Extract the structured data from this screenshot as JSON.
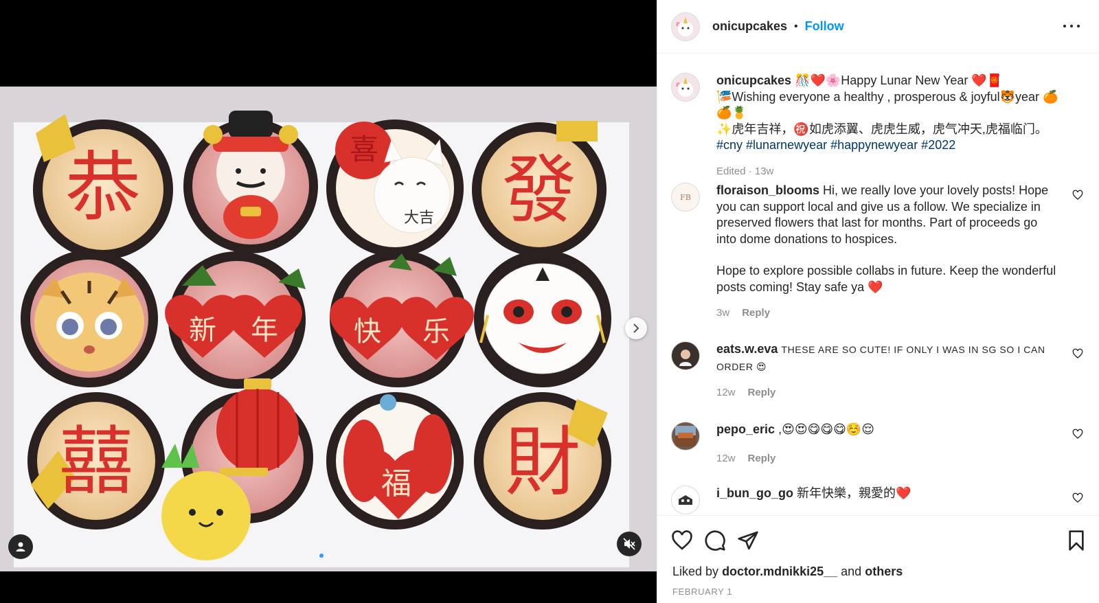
{
  "post": {
    "author": "onicupcakes",
    "follow_label": "Follow",
    "separator": "•",
    "caption_line1": "🎊❤️🌸Happy Lunar New Year ❤️🧧",
    "caption_line2": "🎏Wishing everyone a healthy , prosperous & joyful🐯year 🍊🍊🍍",
    "caption_line3": "✨虎年吉祥，㊗️如虎添翼、虎虎生威，虎气冲天,虎福临门。",
    "hashtags": "#cny #lunarnewyear #happynewyear #2022",
    "edited": "Edited · 13w"
  },
  "comments": [
    {
      "user": "floraison_blooms",
      "text1": "Hi, we really love your lovely posts! Hope you can support local and give us a follow. We specialize in preserved flowers that last for months. Part of proceeds go into dome donations to hospices.",
      "text2": "Hope to explore possible collabs in future. Keep the wonderful posts coming! Stay safe ya ❤️",
      "time": "3w",
      "reply": "Reply"
    },
    {
      "user": "eats.w.eva",
      "text": "These are so cute! If only I was in SG so I can order 😍",
      "time": "12w",
      "reply": "Reply"
    },
    {
      "user": "pepo_eric",
      "text": ",😍😍😋😋😋☺️😌",
      "time": "12w",
      "reply": "Reply"
    },
    {
      "user": "i_bun_go_go",
      "text": "新年快樂，親愛的❤️"
    }
  ],
  "likes": {
    "prefix": "Liked by",
    "user": "doctor.mdnikki25__",
    "conj": "and",
    "others": "others"
  },
  "date": "FEBRUARY 1",
  "icons": [
    "heart-icon",
    "comment-icon",
    "share-icon",
    "bookmark-icon",
    "more-icon",
    "chevron-right-icon",
    "user-tag-icon",
    "mute-icon"
  ],
  "colors": {
    "link": "#0095f6",
    "hashtag": "#00376b",
    "muted": "#8e8e8e",
    "heart": "#ed4956"
  }
}
